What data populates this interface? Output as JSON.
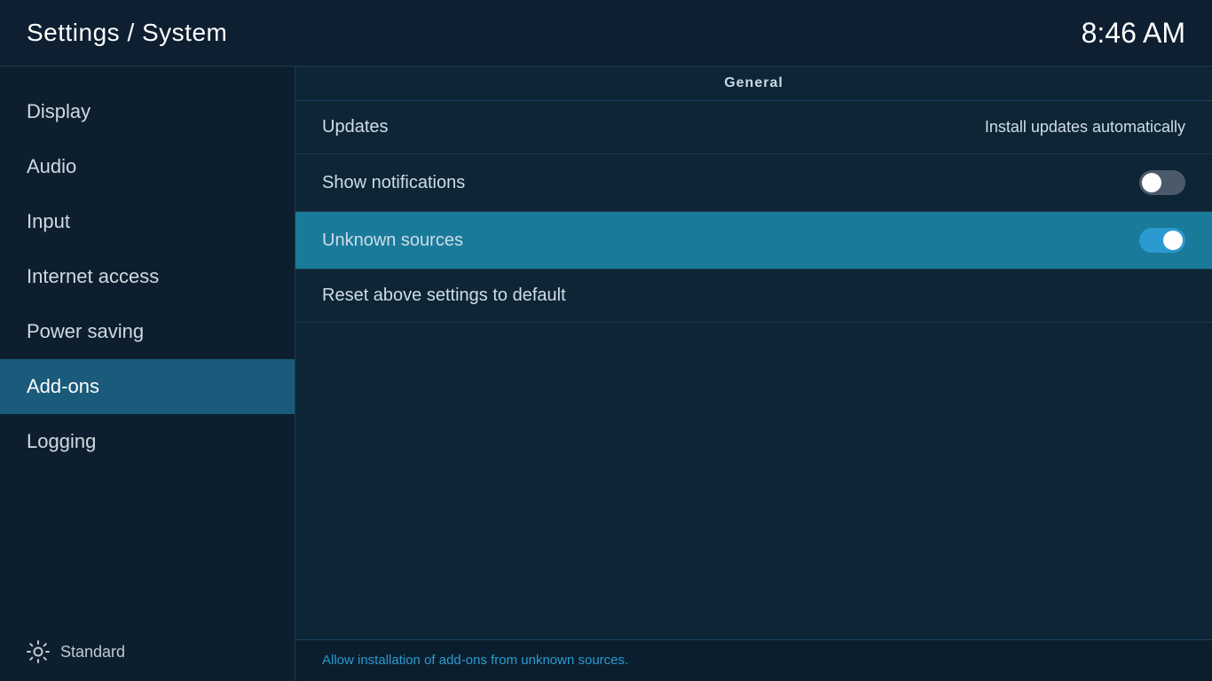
{
  "header": {
    "title": "Settings / System",
    "time": "8:46 AM"
  },
  "sidebar": {
    "items": [
      {
        "id": "display",
        "label": "Display",
        "active": false
      },
      {
        "id": "audio",
        "label": "Audio",
        "active": false
      },
      {
        "id": "input",
        "label": "Input",
        "active": false
      },
      {
        "id": "internet-access",
        "label": "Internet access",
        "active": false
      },
      {
        "id": "power-saving",
        "label": "Power saving",
        "active": false
      },
      {
        "id": "add-ons",
        "label": "Add-ons",
        "active": true
      },
      {
        "id": "logging",
        "label": "Logging",
        "active": false
      }
    ],
    "footer_label": "Standard"
  },
  "content": {
    "section_header": "General",
    "settings": [
      {
        "id": "updates",
        "label": "Updates",
        "value": "Install updates automatically",
        "has_toggle": false,
        "highlighted": false
      },
      {
        "id": "show-notifications",
        "label": "Show notifications",
        "value": "",
        "has_toggle": true,
        "toggle_state": "off",
        "highlighted": false
      },
      {
        "id": "unknown-sources",
        "label": "Unknown sources",
        "value": "",
        "has_toggle": true,
        "toggle_state": "on",
        "highlighted": true
      },
      {
        "id": "reset-settings",
        "label": "Reset above settings to default",
        "value": "",
        "has_toggle": false,
        "highlighted": false
      }
    ],
    "footer_text": "Allow installation of add-ons from unknown sources."
  }
}
